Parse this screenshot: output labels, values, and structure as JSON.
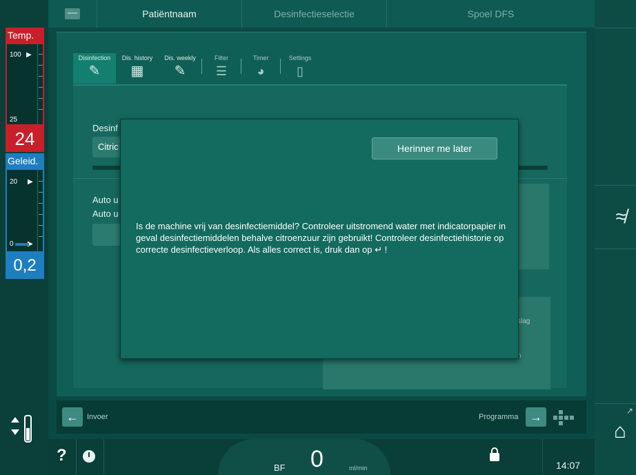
{
  "topbar": {
    "tabs": [
      "Patiëntnaam",
      "Desinfectieselectie",
      "Spoel DFS"
    ]
  },
  "gauges": {
    "temperature": {
      "label": "Temp.",
      "scale_max": "100",
      "scale_min": "25",
      "value": "24",
      "color": "#c8202a"
    },
    "conductivity": {
      "label": "Geleid.",
      "scale_max": "20",
      "scale_min": "0",
      "value": "0,2",
      "color": "#1e7fc0"
    }
  },
  "subtabs": [
    {
      "label": "Disinfection",
      "icon": "disinfection-icon",
      "glyph": "✎",
      "active": true
    },
    {
      "label": "Dis. history",
      "icon": "history-icon",
      "glyph": "▦",
      "active": false
    },
    {
      "label": "Dis. weekly",
      "icon": "weekly-icon",
      "glyph": "✎",
      "active": false
    },
    {
      "label": "Filter",
      "icon": "filter-icon",
      "glyph": "☰",
      "active": false
    },
    {
      "label": "Timer",
      "icon": "timer-icon",
      "glyph": "◕",
      "active": false
    },
    {
      "label": "Settings",
      "icon": "settings-icon",
      "glyph": "▯",
      "active": false
    }
  ],
  "content": {
    "section_label": "Desinf",
    "method_value": "Citric",
    "auto_label_1": "Auto u",
    "auto_label_2": "Auto u",
    "partial_text": "slag",
    "partial_text_2": "n"
  },
  "modal": {
    "remind_button": "Herinner me later",
    "message": "Is de machine vrij van desinfectiemiddel? Controleer uitstromend water met indicatorpapier in geval desinfectiemiddelen behalve citroenzuur zijn gebruikt! Controleer desinfectiehistorie op correcte desinfectieverloop. Als alles correct is, druk dan op ↵ !"
  },
  "navbar": {
    "back_label": "Invoer",
    "next_label": "Programma"
  },
  "statusbar": {
    "help": "?",
    "bf_label": "BF",
    "bf_value": "0",
    "bf_unit": "ml/min",
    "time": "14:07"
  },
  "colors": {
    "accent": "#13806f",
    "background": "#0b4a44"
  }
}
